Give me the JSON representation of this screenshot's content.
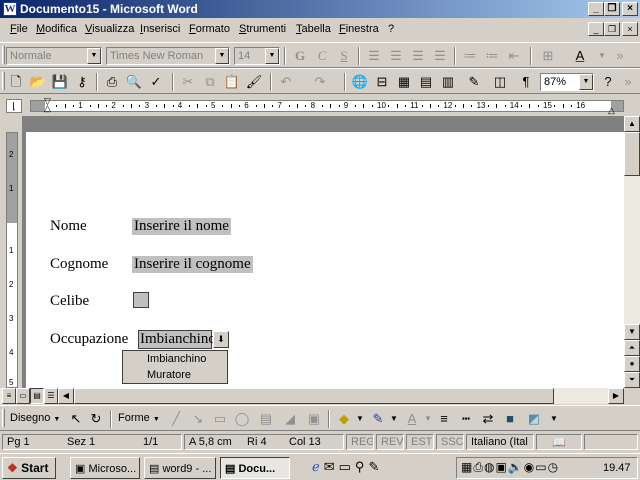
{
  "window": {
    "title": "Documento15 - Microsoft Word",
    "app_icon": "W",
    "minimize_label": "_",
    "restore_label": "❐",
    "close_label": "×"
  },
  "menu": {
    "items": [
      "File",
      "Modifica",
      "Visualizza",
      "Inserisci",
      "Formato",
      "Strumenti",
      "Tabella",
      "Finestra",
      "?"
    ]
  },
  "formatting_toolbar": {
    "style_value": "Normale",
    "font_value": "Times New Roman",
    "size_value": "14",
    "bold": "G",
    "italic": "C",
    "underline": "S"
  },
  "standard_toolbar": {
    "zoom_value": "87%",
    "paragraph_mark": "¶"
  },
  "ruler": {
    "h_numbers": [
      "1",
      "2",
      "3",
      "4",
      "5",
      "6",
      "7",
      "8",
      "9",
      "10",
      "11",
      "12",
      "13",
      "14",
      "15",
      "16"
    ],
    "v_numbers": [
      "2",
      "1",
      "1",
      "2",
      "3",
      "4",
      "5"
    ]
  },
  "form": {
    "rows": [
      {
        "label": "Nome",
        "value": "Inserire il nome"
      },
      {
        "label": "Cognome",
        "value": "Inserire il cognome"
      },
      {
        "label": "Celibe"
      },
      {
        "label": "Occupazione",
        "value": "Imbianchino"
      }
    ],
    "dropdown_options": [
      "Imbianchino",
      "Muratore"
    ]
  },
  "drawing_toolbar": {
    "draw_label": "Disegno",
    "shapes_label": "Forme"
  },
  "status": {
    "page": "Pg 1",
    "section": "Sez 1",
    "pages": "1/1",
    "at": "A  5,8 cm",
    "line": "Ri  4",
    "col": "Col  13",
    "rec": "REG",
    "rev": "REV",
    "ext": "EST",
    "ovr": "SSC",
    "language": "Italiano (Ital"
  },
  "taskbar": {
    "start_label": "Start",
    "tasks": [
      "Microso...",
      "word9 - ...",
      "Docu..."
    ],
    "clock": "19.47"
  },
  "colors": {
    "title_start": "#0a246a",
    "title_end": "#a6caf0",
    "field_shading": "#c0c0c0",
    "face": "#d4d0c8"
  }
}
